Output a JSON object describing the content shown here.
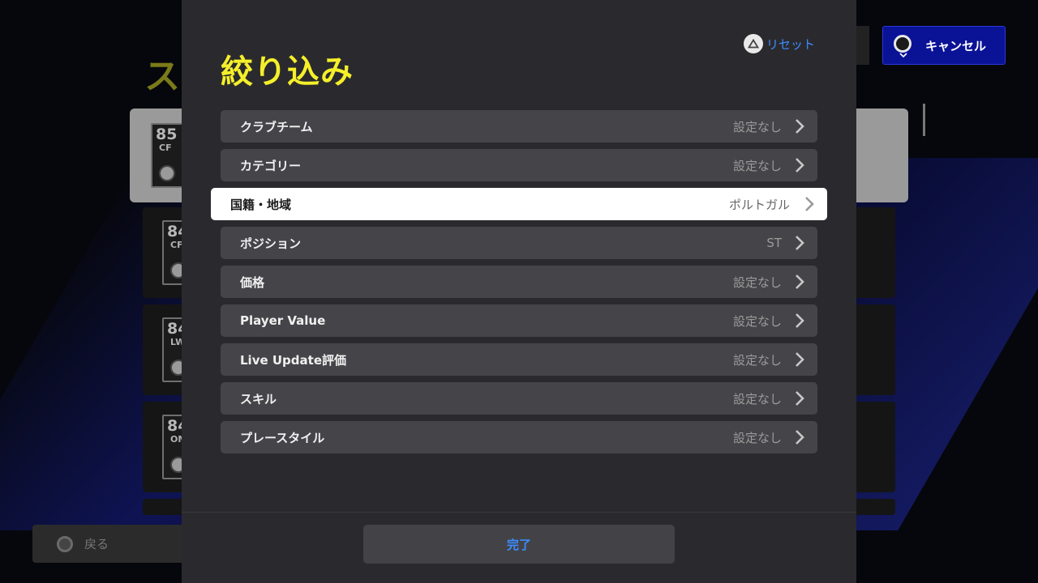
{
  "background": {
    "title_partial": "ス",
    "cards": [
      {
        "rating": "85",
        "position": "CF"
      },
      {
        "rating": "84",
        "position": "CF"
      },
      {
        "rating": "84",
        "position": "LWF"
      },
      {
        "rating": "84",
        "position": "OMF"
      }
    ],
    "back_button": {
      "label": "戻る"
    }
  },
  "cancel_button": {
    "label": "キャンセル"
  },
  "modal": {
    "title": "絞り込み",
    "reset_label": "リセット",
    "filters": [
      {
        "label": "クラブチーム",
        "value": "設定なし"
      },
      {
        "label": "カテゴリー",
        "value": "設定なし"
      },
      {
        "label": "国籍・地域",
        "value": "ポルトガル"
      },
      {
        "label": "ポジション",
        "value": "ST"
      },
      {
        "label": "価格",
        "value": "設定なし"
      },
      {
        "label": "Player Value",
        "value": "設定なし"
      },
      {
        "label": "Live Update評価",
        "value": "設定なし"
      },
      {
        "label": "スキル",
        "value": "設定なし"
      },
      {
        "label": "プレースタイル",
        "value": "設定なし"
      }
    ],
    "done_label": "完了"
  },
  "colors": {
    "title_yellow": "#f5ef2a",
    "accent_blue": "#3c8cff",
    "cancel_bg": "#0a1396"
  },
  "icons": {
    "reset": "triangle-button-icon",
    "cancel": "circle-button-icon",
    "back": "circle-button-icon",
    "row": "chevron-right-icon"
  }
}
